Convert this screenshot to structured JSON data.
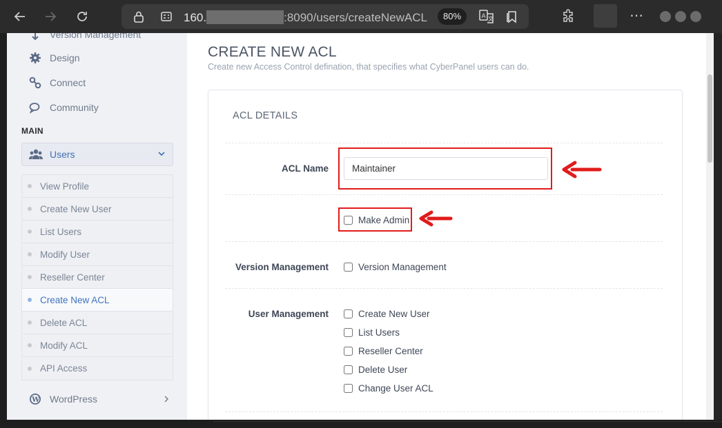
{
  "browser": {
    "url_prefix": "160.",
    "url_suffix": ":8090/users/createNewACL",
    "zoom": "80%",
    "icons": [
      "back-arrow-icon",
      "forward-arrow-icon",
      "reload-icon",
      "lock-icon",
      "site-info-icon",
      "translate-icon",
      "reading-list-icon",
      "extensions-icon",
      "more-icon"
    ]
  },
  "sidebar": {
    "top_links": [
      {
        "label": "Version Management",
        "icon": "version-icon"
      },
      {
        "label": "Design",
        "icon": "gear-icon"
      },
      {
        "label": "Connect",
        "icon": "link-icon"
      },
      {
        "label": "Community",
        "icon": "chat-icon"
      }
    ],
    "main_label": "MAIN",
    "users_label": "Users",
    "sub_items": [
      "View Profile",
      "Create New User",
      "List Users",
      "Modify User",
      "Reseller Center",
      "Create New ACL",
      "Delete ACL",
      "Modify ACL",
      "API Access"
    ],
    "active_item": "Create New ACL",
    "wordpress_label": "WordPress"
  },
  "main": {
    "title": "CREATE NEW ACL",
    "subtitle": "Create new Access Control defination, that specifies what CyberPanel users can do.",
    "card_title": "ACL DETAILS",
    "acl_name_label": "ACL Name",
    "acl_name_value": "Maintainer",
    "make_admin_label": "Make Admin",
    "version_management": {
      "label": "Version Management",
      "options": [
        "Version Management"
      ]
    },
    "user_management": {
      "label": "User Management",
      "options": [
        "Create New User",
        "List Users",
        "Reseller Center",
        "Delete User",
        "Change User ACL"
      ]
    }
  },
  "colors": {
    "accent": "#3f73c0",
    "annotation": "#e11b1b",
    "sidebar_bg": "#f0f1f5"
  }
}
